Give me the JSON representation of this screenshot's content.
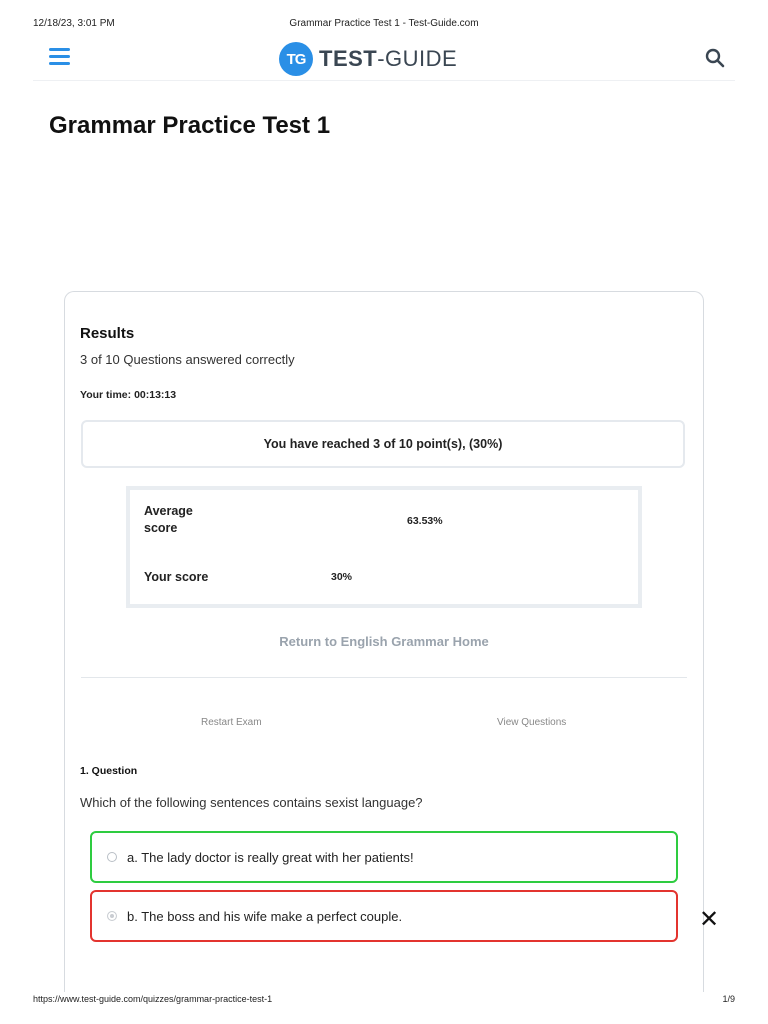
{
  "print_header": {
    "datetime": "12/18/23, 3:01 PM",
    "doc_title": "Grammar Practice Test 1 - Test-Guide.com"
  },
  "site_header": {
    "logo_mark": "TG",
    "logo_text_bold": "TEST",
    "logo_text_rest": "-GUIDE",
    "menu_icon": "hamburger-menu-icon",
    "search_icon": "search-icon",
    "accent_color": "#2a8fe6"
  },
  "page": {
    "title": "Grammar Practice Test 1"
  },
  "results": {
    "heading": "Results",
    "answered_text": "3 of 10 Questions answered correctly",
    "time_label": "Your time:",
    "time_value": "00:13:13",
    "points_text": "You have reached 3 of 10 point(s), (30%)",
    "average_label_line1": "Average",
    "average_label_line2": "score",
    "average_value": "63.53%",
    "your_score_label": "Your score",
    "your_score_value": "30%",
    "return_link": "Return to English Grammar Home",
    "restart_button": "Restart Exam",
    "view_questions_button": "View Questions"
  },
  "question": {
    "number": "1. Question",
    "text": "Which of the following sentences contains sexist language?",
    "answers": [
      {
        "label": "a. The lady doctor is really great with her patients!",
        "state": "correct",
        "selected": false
      },
      {
        "label": "b. The boss and his wife make a perfect couple.",
        "state": "incorrect",
        "selected": true
      }
    ]
  },
  "colors": {
    "correct": "#2ecc40",
    "incorrect": "#e3342f"
  },
  "close_icon": "close-icon",
  "print_footer": {
    "url": "https://www.test-guide.com/quizzes/grammar-practice-test-1",
    "page": "1/9"
  }
}
